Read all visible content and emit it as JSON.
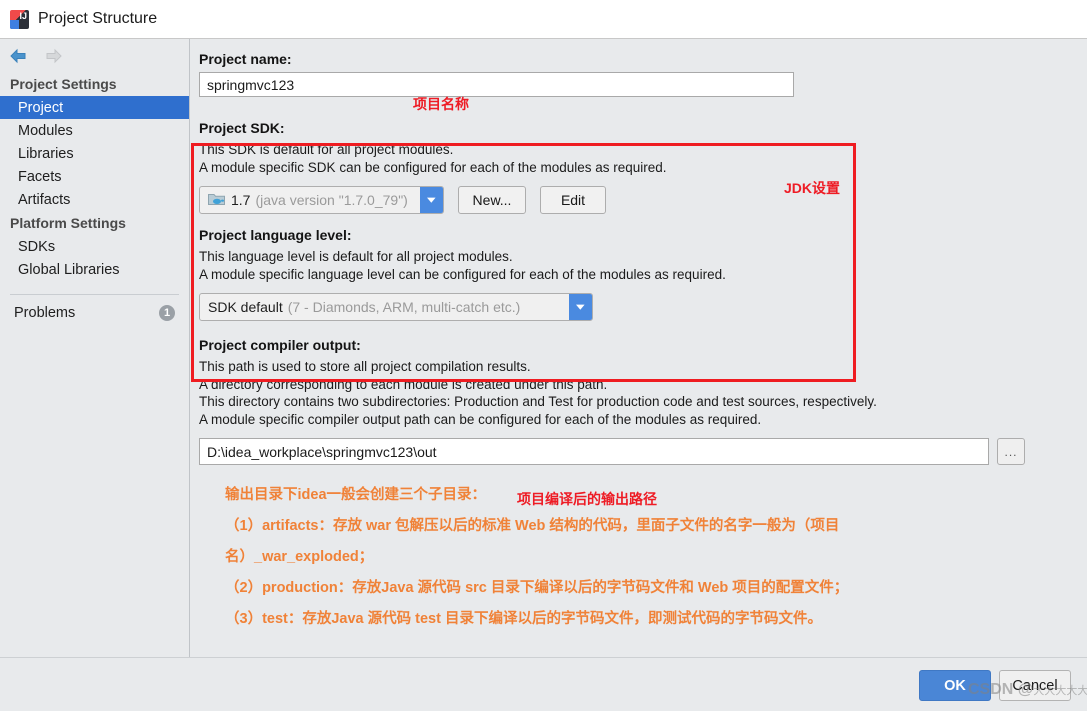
{
  "window": {
    "title": "Project Structure",
    "app_icon": "intellij-idea-icon"
  },
  "nav": {
    "back_icon": "arrow-left-icon",
    "forward_icon": "arrow-right-icon"
  },
  "sidebar": {
    "groups": [
      {
        "header": "Project Settings",
        "items": [
          {
            "label": "Project",
            "selected": true
          },
          {
            "label": "Modules",
            "selected": false
          },
          {
            "label": "Libraries",
            "selected": false
          },
          {
            "label": "Facets",
            "selected": false
          },
          {
            "label": "Artifacts",
            "selected": false
          }
        ]
      },
      {
        "header": "Platform Settings",
        "items": [
          {
            "label": "SDKs",
            "selected": false
          },
          {
            "label": "Global Libraries",
            "selected": false
          }
        ]
      }
    ],
    "problems": {
      "label": "Problems",
      "count": "1"
    }
  },
  "project_name": {
    "label": "Project name:",
    "value": "springmvc123",
    "annotation": "项目名称"
  },
  "project_sdk": {
    "label": "Project SDK:",
    "desc1": "This SDK is default for all project modules.",
    "desc2": "A module specific SDK can be configured for each of the modules as required.",
    "combo_value": "1.7",
    "combo_detail": "(java version \"1.7.0_79\")",
    "combo_icon": "folder-java-icon",
    "new_button": "New...",
    "edit_button": "Edit",
    "annotation": "JDK设置"
  },
  "project_language_level": {
    "label": "Project language level:",
    "desc1": "This language level is default for all project modules.",
    "desc2": "A module specific language level can be configured for each of the modules as required.",
    "combo_value": "SDK default",
    "combo_detail": "(7 - Diamonds, ARM, multi-catch etc.)"
  },
  "project_compiler_output": {
    "label": "Project compiler output:",
    "desc1": "This path is used to store all project compilation results.",
    "desc2": "A directory corresponding to each module is created under this path.",
    "desc3": "This directory contains two subdirectories: Production and Test for production code and test sources, respectively.",
    "desc4": "A module specific compiler output path can be configured for each of the modules as required.",
    "path_value": "D:\\idea_workplace\\springmvc123\\out",
    "browse_label": "...",
    "annotation": "项目编译后的输出路径"
  },
  "notes": {
    "lines": [
      "输出目录下idea一般会创建三个子目录：",
      "（1）artifacts：存放 war 包解压以后的标准 Web 结构的代码，里面子文件的名字一般为（项目",
      "名）_war_exploded；",
      "（2）production：存放Java 源代码 src 目录下编译以后的字节码文件和 Web 项目的配置文件；",
      "（3）test：存放Java 源代码 test 目录下编译以后的字节码文件，即测试代码的字节码文件。"
    ]
  },
  "footer": {
    "ok_label": "OK",
    "cancel_label": "Cancel"
  },
  "watermark": {
    "text": "CSDN @",
    "sub": "大大大大大"
  },
  "colors": {
    "selection_blue": "#2f6fce",
    "annotation_red": "#ee1c25",
    "annotation_orange": "#f08238",
    "combo_arrow_blue": "#4a8ae0",
    "ok_button_blue": "#4a86d6",
    "panel_bg": "#e8eaec"
  }
}
